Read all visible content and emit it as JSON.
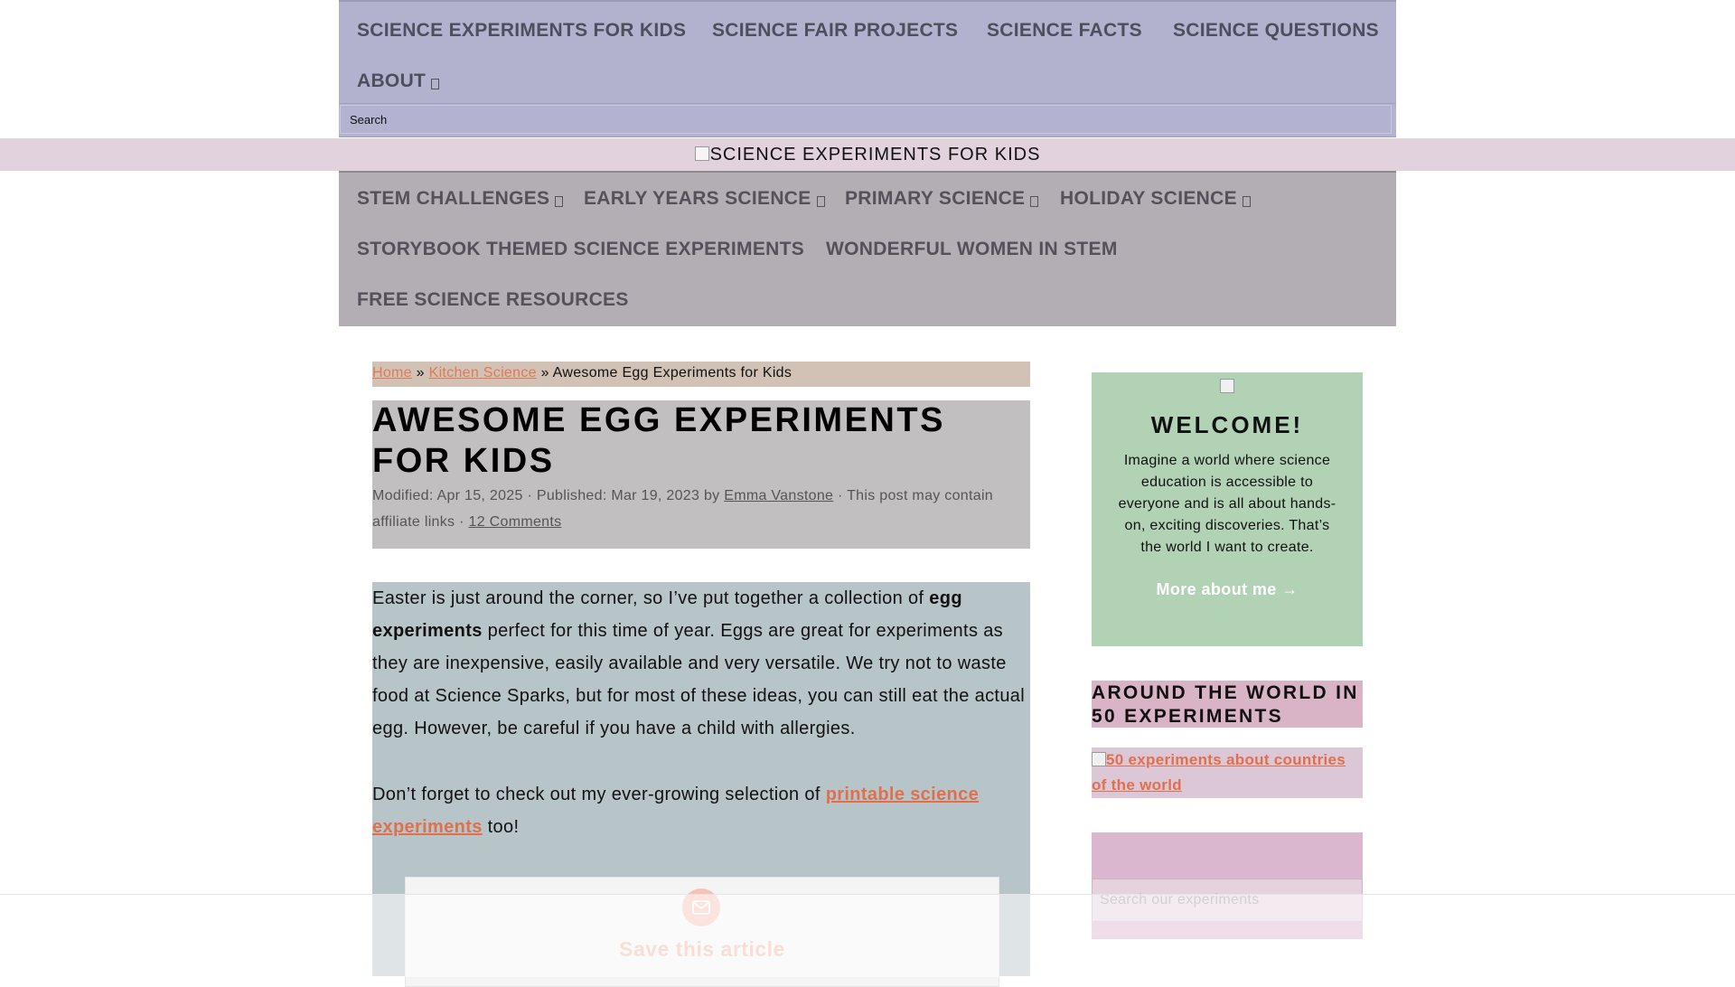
{
  "top_nav": {
    "items": [
      {
        "label": "SCIENCE EXPERIMENTS FOR KIDS"
      },
      {
        "label": "SCIENCE FAIR PROJECTS"
      },
      {
        "label": "SCIENCE FACTS"
      },
      {
        "label": "SCIENCE QUESTIONS"
      },
      {
        "label": "ABOUT"
      }
    ],
    "search_placeholder": "Search"
  },
  "logo": {
    "alt": "SCIENCE EXPERIMENTS FOR KIDS"
  },
  "main_nav": {
    "items": [
      {
        "label": "STEM CHALLENGES"
      },
      {
        "label": "EARLY YEARS SCIENCE"
      },
      {
        "label": "PRIMARY SCIENCE"
      },
      {
        "label": "HOLIDAY SCIENCE"
      },
      {
        "label": "STORYBOOK THEMED SCIENCE EXPERIMENTS"
      },
      {
        "label": "WONDERFUL WOMEN IN STEM"
      },
      {
        "label": "FREE SCIENCE RESOURCES"
      }
    ]
  },
  "breadcrumb": {
    "home": "Home",
    "sep": "»",
    "category": "Kitchen Science",
    "current": "Awesome Egg Experiments for Kids"
  },
  "article": {
    "title": "AWESOME EGG EXPERIMENTS FOR KIDS",
    "meta": {
      "modified": "Modified: Apr 15, 2025",
      "dot": "·",
      "published": "Published: Mar 19, 2023",
      "by": "by",
      "author": "Emma Vanstone",
      "affiliate": "This post may contain affiliate links",
      "comments": "12 Comments"
    },
    "p1_before": "Easter is just around the corner, so I’ve put together a collection of ",
    "p1_bold": "egg experiments",
    "p1_after": " perfect for this time of year. Eggs are great for experiments as they are inexpensive, easily available and very versatile. We try not to waste food at Science Sparks, but for most of these ideas, you can still eat the actual egg. However, be careful if you have a child with allergies.",
    "p2_before": "Don’t forget to check out my ever-growing selection of ",
    "p2_link": "printable science experiments",
    "p2_after": " too!",
    "save": {
      "title": "Save this article",
      "icon": "mail-icon"
    }
  },
  "sidebar": {
    "welcome": {
      "title": "WELCOME!",
      "text": "Imagine a world where science education is accessible to everyone and is all about hands-on, exciting discoveries. That’s the world I want to create.",
      "more": "More about me →"
    },
    "world": {
      "title": "AROUND THE WORLD IN 50 EXPERIMENTS",
      "link": "50 experiments about countries of the world"
    },
    "search_placeholder": "Search our experiments"
  }
}
